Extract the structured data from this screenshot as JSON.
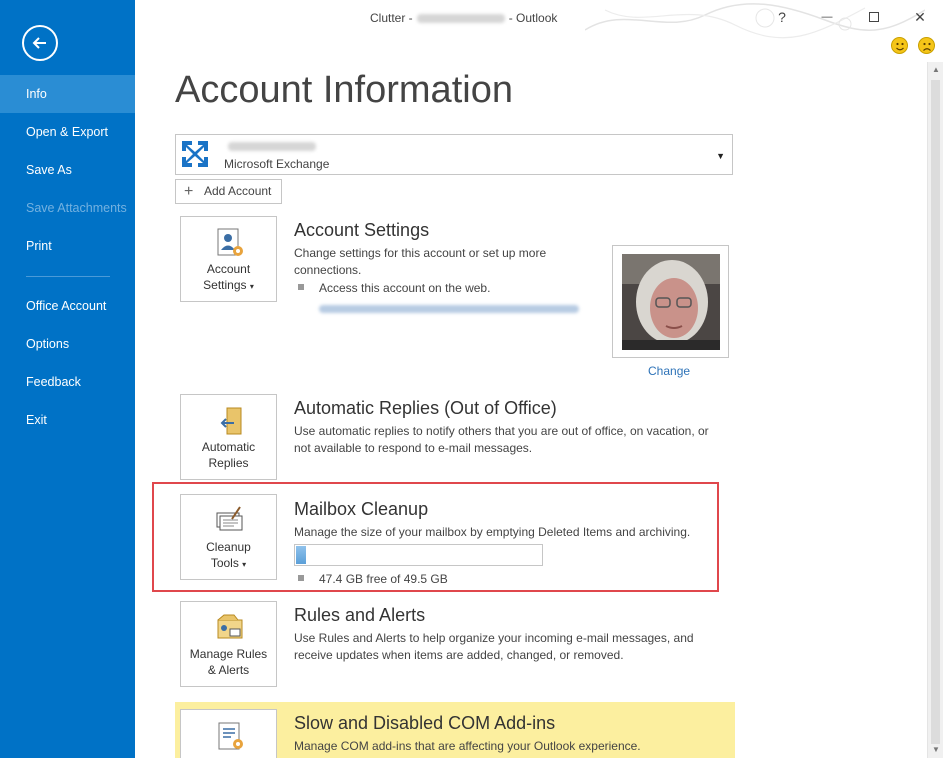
{
  "window": {
    "title_prefix": "Clutter -",
    "title_suffix": "- Outlook",
    "help": "?",
    "minimize": "—",
    "close": "✕"
  },
  "sidebar": {
    "items": [
      {
        "label": "Info"
      },
      {
        "label": "Open & Export"
      },
      {
        "label": "Save As"
      },
      {
        "label": "Save Attachments"
      },
      {
        "label": "Print"
      },
      {
        "label": "Office Account"
      },
      {
        "label": "Options"
      },
      {
        "label": "Feedback"
      },
      {
        "label": "Exit"
      }
    ]
  },
  "main": {
    "title": "Account Information",
    "account_selector": {
      "type": "Microsoft Exchange"
    },
    "add_account": "Add Account",
    "account_settings": {
      "tile_line1": "Account",
      "tile_line2": "Settings",
      "title": "Account Settings",
      "desc": "Change settings for this account or set up more connections.",
      "bullet": "Access this account on the web.",
      "change": "Change"
    },
    "auto_replies": {
      "tile_line1": "Automatic",
      "tile_line2": "Replies",
      "title": "Automatic Replies (Out of Office)",
      "desc": "Use automatic replies to notify others that you are out of office, on vacation, or not available to respond to e-mail messages."
    },
    "mailbox_cleanup": {
      "tile_line1": "Cleanup",
      "tile_line2": "Tools",
      "title": "Mailbox Cleanup",
      "desc": "Manage the size of your mailbox by emptying Deleted Items and archiving.",
      "usage_fraction": 0.04,
      "free_text": "47.4 GB free of 49.5 GB"
    },
    "rules_alerts": {
      "tile_line1": "Manage Rules",
      "tile_line2": "& Alerts",
      "title": "Rules and Alerts",
      "desc": "Use Rules and Alerts to help organize your incoming e-mail messages, and receive updates when items are added, changed, or removed."
    },
    "com_addins": {
      "title": "Slow and Disabled COM Add-ins",
      "desc": "Manage COM add-ins that are affecting your Outlook experience."
    }
  },
  "colors": {
    "sidebar_bg": "#0072c6",
    "sidebar_active": "#2a8dd4",
    "highlight_border": "#e0474c",
    "com_band": "#fcef9f"
  }
}
